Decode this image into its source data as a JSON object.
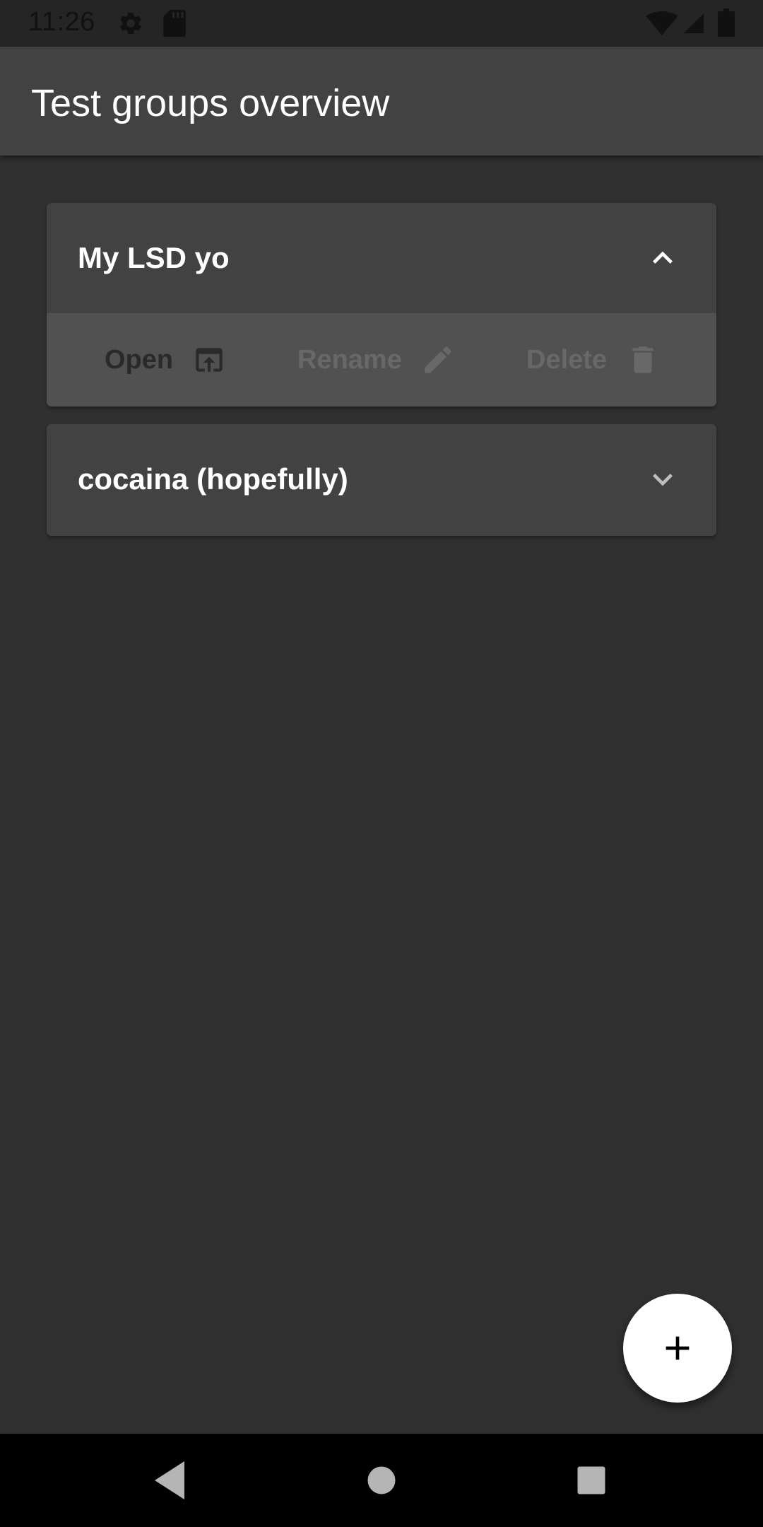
{
  "status_bar": {
    "time": "11:26",
    "icons": [
      "settings-icon",
      "sd-card-icon",
      "wifi-icon",
      "signal-icon",
      "battery-icon"
    ]
  },
  "app_bar": {
    "title": "Test groups overview"
  },
  "groups": [
    {
      "name": "My LSD yo",
      "expanded": true,
      "actions": [
        {
          "label": "Open",
          "icon": "open-in-icon",
          "enabled": true
        },
        {
          "label": "Rename",
          "icon": "pencil-icon",
          "enabled": false
        },
        {
          "label": "Delete",
          "icon": "trash-icon",
          "enabled": false
        }
      ]
    },
    {
      "name": "cocaina (hopefully)",
      "expanded": false
    }
  ],
  "fab": {
    "icon": "plus-icon"
  },
  "nav_bar": {
    "buttons": [
      "back-icon",
      "home-icon",
      "recents-icon"
    ]
  },
  "colors": {
    "background": "#303030",
    "surface": "#424242",
    "actions_surface": "#515151",
    "enabled_action_text": "#2a2a2a",
    "disabled_action_text": "#686868",
    "fab": "#ffffff"
  }
}
